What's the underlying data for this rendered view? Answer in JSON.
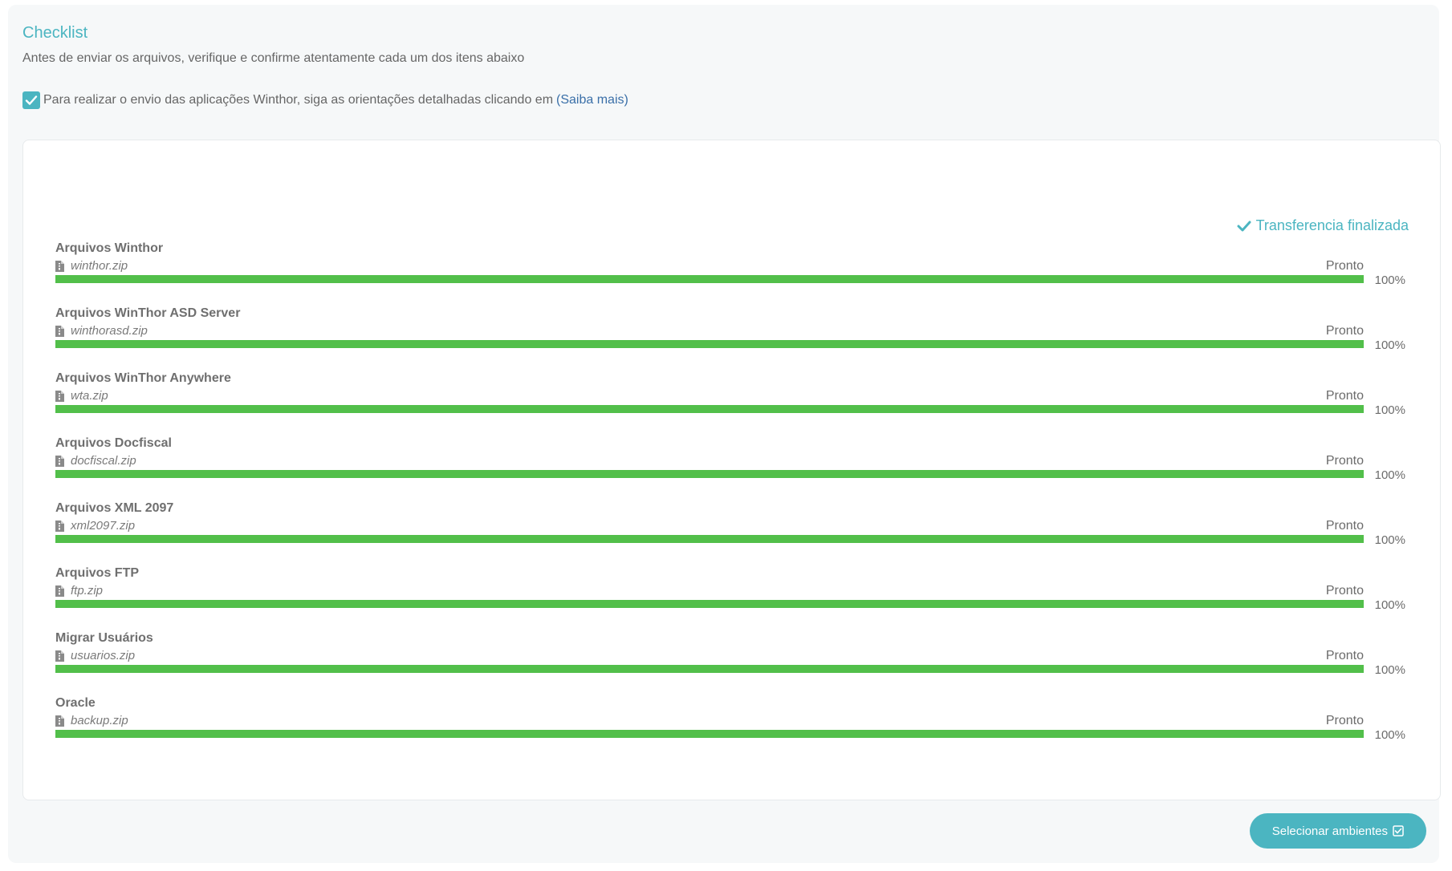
{
  "header": {
    "title": "Checklist",
    "subtitle": "Antes de enviar os arquivos, verifique e confirme atentamente cada um dos itens abaixo"
  },
  "notice": {
    "checked": true,
    "text": "Para realizar o envio das aplicações Winthor, siga as orientações detalhadas clicando em",
    "link_label": "(Saiba mais)"
  },
  "transfer": {
    "status_label": "Transferencia finalizada",
    "items": [
      {
        "name": "Arquivos Winthor",
        "file": "winthor.zip",
        "status": "Pronto",
        "progress": 100,
        "percent_label": "100%"
      },
      {
        "name": "Arquivos WinThor ASD Server",
        "file": "winthorasd.zip",
        "status": "Pronto",
        "progress": 100,
        "percent_label": "100%"
      },
      {
        "name": "Arquivos WinThor Anywhere",
        "file": "wta.zip",
        "status": "Pronto",
        "progress": 100,
        "percent_label": "100%"
      },
      {
        "name": "Arquivos Docfiscal",
        "file": "docfiscal.zip",
        "status": "Pronto",
        "progress": 100,
        "percent_label": "100%"
      },
      {
        "name": "Arquivos XML 2097",
        "file": "xml2097.zip",
        "status": "Pronto",
        "progress": 100,
        "percent_label": "100%"
      },
      {
        "name": "Arquivos FTP",
        "file": "ftp.zip",
        "status": "Pronto",
        "progress": 100,
        "percent_label": "100%"
      },
      {
        "name": "Migrar Usuários",
        "file": "usuarios.zip",
        "status": "Pronto",
        "progress": 100,
        "percent_label": "100%"
      },
      {
        "name": "Oracle",
        "file": "backup.zip",
        "status": "Pronto",
        "progress": 100,
        "percent_label": "100%"
      }
    ]
  },
  "footer": {
    "button_label": "Selecionar ambientes"
  },
  "colors": {
    "accent": "#4bb5c1",
    "progress": "#52bf4a",
    "link": "#3a6fa8"
  }
}
